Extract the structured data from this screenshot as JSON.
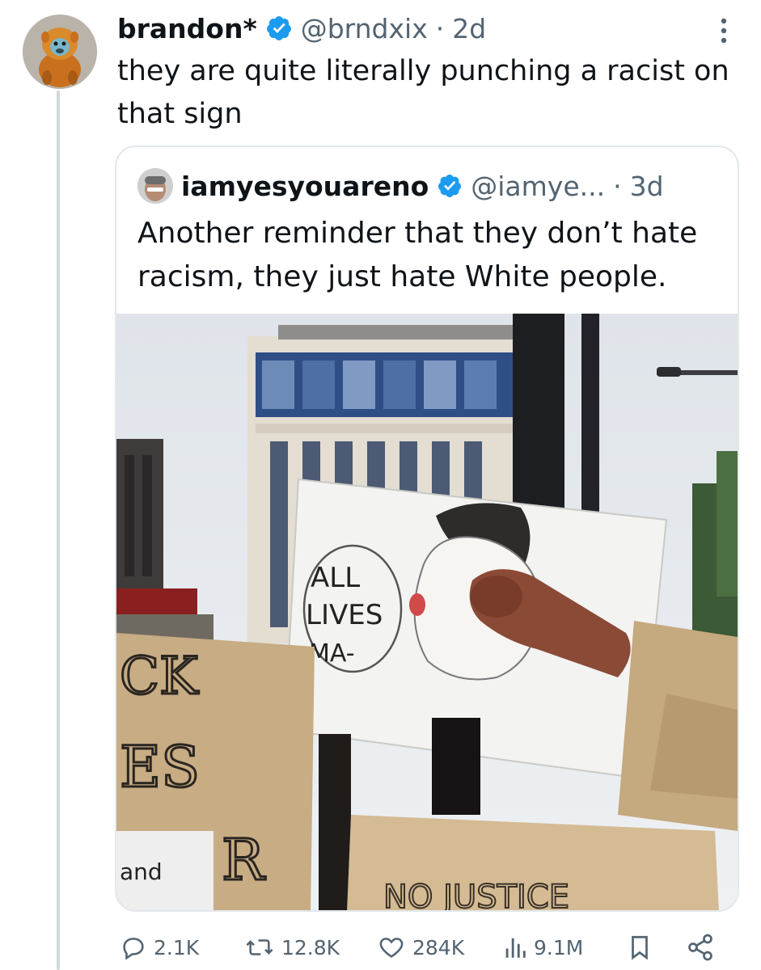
{
  "tweet": {
    "author_name": "brandon*",
    "handle": "@brndxix",
    "separator": "·",
    "time": "2d",
    "text": "they are quite literally punching a racist on that sign"
  },
  "quoted_tweet": {
    "author_name": "iamyesyouareno",
    "handle": "@iamye...",
    "separator": "·",
    "time": "3d",
    "text": "Another reminder that they don’t hate racism, they just hate White people."
  },
  "image_text": {
    "speech_bubble": [
      "ALL",
      "LIVES",
      "MA-"
    ],
    "left_sign": [
      "CK",
      "ES",
      "R"
    ],
    "small_card": "and",
    "bottom_sign": "NO JUSTICE"
  },
  "actions": {
    "replies": "2.1K",
    "reposts": "12.8K",
    "likes": "284K",
    "views": "9.1M"
  },
  "icons": {
    "verified": "verified-badge-icon",
    "more": "more-options-icon",
    "reply": "reply-icon",
    "repost": "repost-icon",
    "like": "like-icon",
    "views": "views-icon",
    "bookmark": "bookmark-icon",
    "share": "share-icon"
  },
  "colors": {
    "text_primary": "#0f1419",
    "text_secondary": "#536471",
    "verified_blue": "#1d9bf0",
    "border": "#e3e8ec",
    "thread_line": "#cfd9de"
  }
}
